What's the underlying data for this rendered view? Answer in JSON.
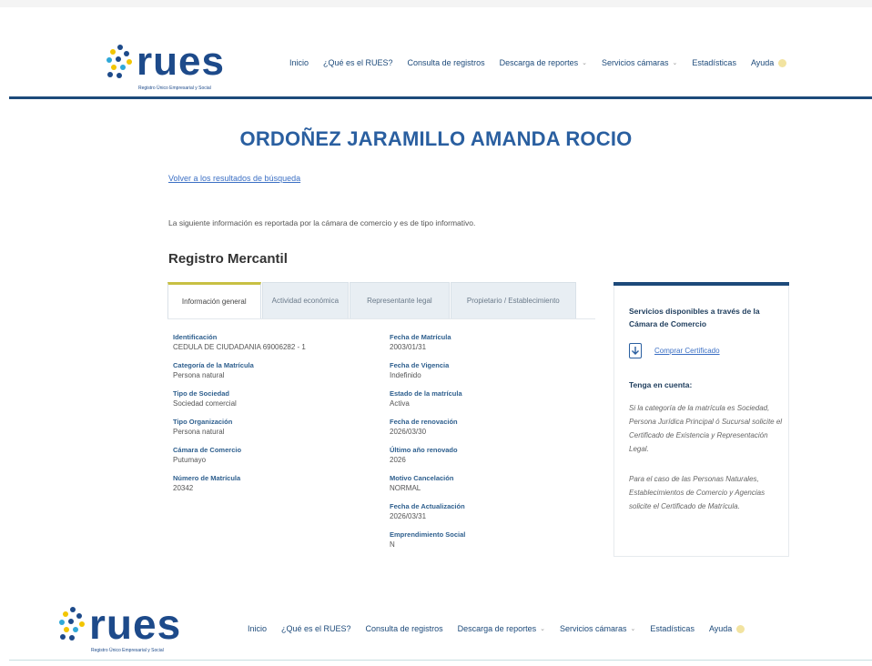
{
  "brand": {
    "name": "rues",
    "tagline": "Registro Único Empresarial y Social"
  },
  "nav": {
    "items": [
      {
        "label": "Inicio",
        "caret": false
      },
      {
        "label": "¿Qué es el RUES?",
        "caret": false
      },
      {
        "label": "Consulta de registros",
        "caret": false
      },
      {
        "label": "Descarga de reportes",
        "caret": true
      },
      {
        "label": "Servicios cámaras",
        "caret": true
      },
      {
        "label": "Estadísticas",
        "caret": false
      },
      {
        "label": "Ayuda",
        "caret": false
      }
    ]
  },
  "page": {
    "title": "ORDOÑEZ JARAMILLO AMANDA ROCIO",
    "back_link": "Volver a los resultados de búsqueda",
    "intro": "La siguiente información es reportada por la cámara de comercio y es de tipo informativo.",
    "section_title": "Registro Mercantil"
  },
  "tabs": [
    {
      "label": "Información general",
      "active": true
    },
    {
      "label": "Actividad económica",
      "active": false
    },
    {
      "label": "Representante legal",
      "active": false
    },
    {
      "label": "Propietario / Establecimiento",
      "active": false
    }
  ],
  "details": {
    "left": [
      {
        "label": "Identificación",
        "value": "CEDULA DE CIUDADANIA 69006282 - 1"
      },
      {
        "label": "Categoría de la Matrícula",
        "value": "Persona natural"
      },
      {
        "label": "Tipo de Sociedad",
        "value": "Sociedad comercial"
      },
      {
        "label": "Tipo Organización",
        "value": "Persona natural"
      },
      {
        "label": "Cámara de Comercio",
        "value": "Putumayo"
      },
      {
        "label": "Número de Matrícula",
        "value": "20342"
      }
    ],
    "right": [
      {
        "label": "Fecha de Matrícula",
        "value": "2003/01/31"
      },
      {
        "label": "Fecha de Vigencia",
        "value": "Indefinido"
      },
      {
        "label": "Estado de la matrícula",
        "value": "Activa"
      },
      {
        "label": "Fecha de renovación",
        "value": "2026/03/30"
      },
      {
        "label": "Último año renovado",
        "value": "2026"
      },
      {
        "label": "Motivo Cancelación",
        "value": "NORMAL"
      },
      {
        "label": "Fecha de Actualización",
        "value": "2026/03/31"
      },
      {
        "label": "Emprendimiento Social",
        "value": "N"
      }
    ]
  },
  "sidebar": {
    "heading": "Servicios disponibles a través de la Cámara de Comercio",
    "download_link": "Comprar Certificado",
    "tenga_title": "Tenga en cuenta:",
    "note1": "Si la categoría de la matrícula es Sociedad, Persona Jurídica Principal ó Sucursal solicite el Certificado de Existencia y Representación Legal.",
    "note2": "Para el caso de las Personas Naturales, Establecimientos de Comercio y Agencias solicite el Certificado de Matrícula."
  },
  "colors": {
    "primary": "#1d4a7a",
    "title_blue": "#2a5fa0",
    "accent_yellow": "#c8c043"
  }
}
